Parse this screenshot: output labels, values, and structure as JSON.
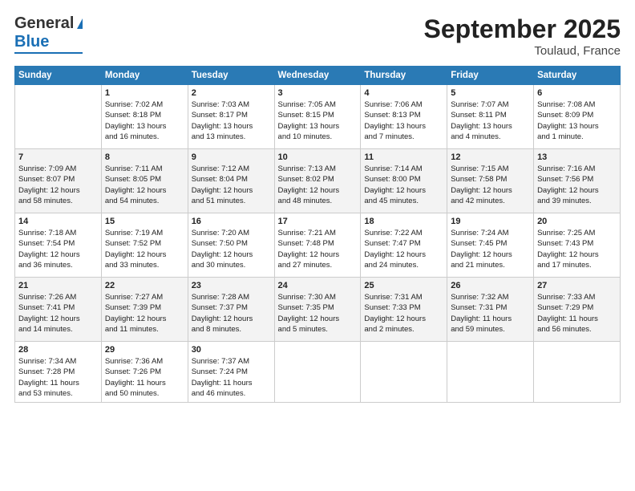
{
  "logo": {
    "line1": "General",
    "line2": "Blue"
  },
  "title": "September 2025",
  "subtitle": "Toulaud, France",
  "headers": [
    "Sunday",
    "Monday",
    "Tuesday",
    "Wednesday",
    "Thursday",
    "Friday",
    "Saturday"
  ],
  "weeks": [
    [
      {
        "day": "",
        "text": ""
      },
      {
        "day": "1",
        "text": "Sunrise: 7:02 AM\nSunset: 8:18 PM\nDaylight: 13 hours\nand 16 minutes."
      },
      {
        "day": "2",
        "text": "Sunrise: 7:03 AM\nSunset: 8:17 PM\nDaylight: 13 hours\nand 13 minutes."
      },
      {
        "day": "3",
        "text": "Sunrise: 7:05 AM\nSunset: 8:15 PM\nDaylight: 13 hours\nand 10 minutes."
      },
      {
        "day": "4",
        "text": "Sunrise: 7:06 AM\nSunset: 8:13 PM\nDaylight: 13 hours\nand 7 minutes."
      },
      {
        "day": "5",
        "text": "Sunrise: 7:07 AM\nSunset: 8:11 PM\nDaylight: 13 hours\nand 4 minutes."
      },
      {
        "day": "6",
        "text": "Sunrise: 7:08 AM\nSunset: 8:09 PM\nDaylight: 13 hours\nand 1 minute."
      }
    ],
    [
      {
        "day": "7",
        "text": "Sunrise: 7:09 AM\nSunset: 8:07 PM\nDaylight: 12 hours\nand 58 minutes."
      },
      {
        "day": "8",
        "text": "Sunrise: 7:11 AM\nSunset: 8:05 PM\nDaylight: 12 hours\nand 54 minutes."
      },
      {
        "day": "9",
        "text": "Sunrise: 7:12 AM\nSunset: 8:04 PM\nDaylight: 12 hours\nand 51 minutes."
      },
      {
        "day": "10",
        "text": "Sunrise: 7:13 AM\nSunset: 8:02 PM\nDaylight: 12 hours\nand 48 minutes."
      },
      {
        "day": "11",
        "text": "Sunrise: 7:14 AM\nSunset: 8:00 PM\nDaylight: 12 hours\nand 45 minutes."
      },
      {
        "day": "12",
        "text": "Sunrise: 7:15 AM\nSunset: 7:58 PM\nDaylight: 12 hours\nand 42 minutes."
      },
      {
        "day": "13",
        "text": "Sunrise: 7:16 AM\nSunset: 7:56 PM\nDaylight: 12 hours\nand 39 minutes."
      }
    ],
    [
      {
        "day": "14",
        "text": "Sunrise: 7:18 AM\nSunset: 7:54 PM\nDaylight: 12 hours\nand 36 minutes."
      },
      {
        "day": "15",
        "text": "Sunrise: 7:19 AM\nSunset: 7:52 PM\nDaylight: 12 hours\nand 33 minutes."
      },
      {
        "day": "16",
        "text": "Sunrise: 7:20 AM\nSunset: 7:50 PM\nDaylight: 12 hours\nand 30 minutes."
      },
      {
        "day": "17",
        "text": "Sunrise: 7:21 AM\nSunset: 7:48 PM\nDaylight: 12 hours\nand 27 minutes."
      },
      {
        "day": "18",
        "text": "Sunrise: 7:22 AM\nSunset: 7:47 PM\nDaylight: 12 hours\nand 24 minutes."
      },
      {
        "day": "19",
        "text": "Sunrise: 7:24 AM\nSunset: 7:45 PM\nDaylight: 12 hours\nand 21 minutes."
      },
      {
        "day": "20",
        "text": "Sunrise: 7:25 AM\nSunset: 7:43 PM\nDaylight: 12 hours\nand 17 minutes."
      }
    ],
    [
      {
        "day": "21",
        "text": "Sunrise: 7:26 AM\nSunset: 7:41 PM\nDaylight: 12 hours\nand 14 minutes."
      },
      {
        "day": "22",
        "text": "Sunrise: 7:27 AM\nSunset: 7:39 PM\nDaylight: 12 hours\nand 11 minutes."
      },
      {
        "day": "23",
        "text": "Sunrise: 7:28 AM\nSunset: 7:37 PM\nDaylight: 12 hours\nand 8 minutes."
      },
      {
        "day": "24",
        "text": "Sunrise: 7:30 AM\nSunset: 7:35 PM\nDaylight: 12 hours\nand 5 minutes."
      },
      {
        "day": "25",
        "text": "Sunrise: 7:31 AM\nSunset: 7:33 PM\nDaylight: 12 hours\nand 2 minutes."
      },
      {
        "day": "26",
        "text": "Sunrise: 7:32 AM\nSunset: 7:31 PM\nDaylight: 11 hours\nand 59 minutes."
      },
      {
        "day": "27",
        "text": "Sunrise: 7:33 AM\nSunset: 7:29 PM\nDaylight: 11 hours\nand 56 minutes."
      }
    ],
    [
      {
        "day": "28",
        "text": "Sunrise: 7:34 AM\nSunset: 7:28 PM\nDaylight: 11 hours\nand 53 minutes."
      },
      {
        "day": "29",
        "text": "Sunrise: 7:36 AM\nSunset: 7:26 PM\nDaylight: 11 hours\nand 50 minutes."
      },
      {
        "day": "30",
        "text": "Sunrise: 7:37 AM\nSunset: 7:24 PM\nDaylight: 11 hours\nand 46 minutes."
      },
      {
        "day": "",
        "text": ""
      },
      {
        "day": "",
        "text": ""
      },
      {
        "day": "",
        "text": ""
      },
      {
        "day": "",
        "text": ""
      }
    ]
  ]
}
